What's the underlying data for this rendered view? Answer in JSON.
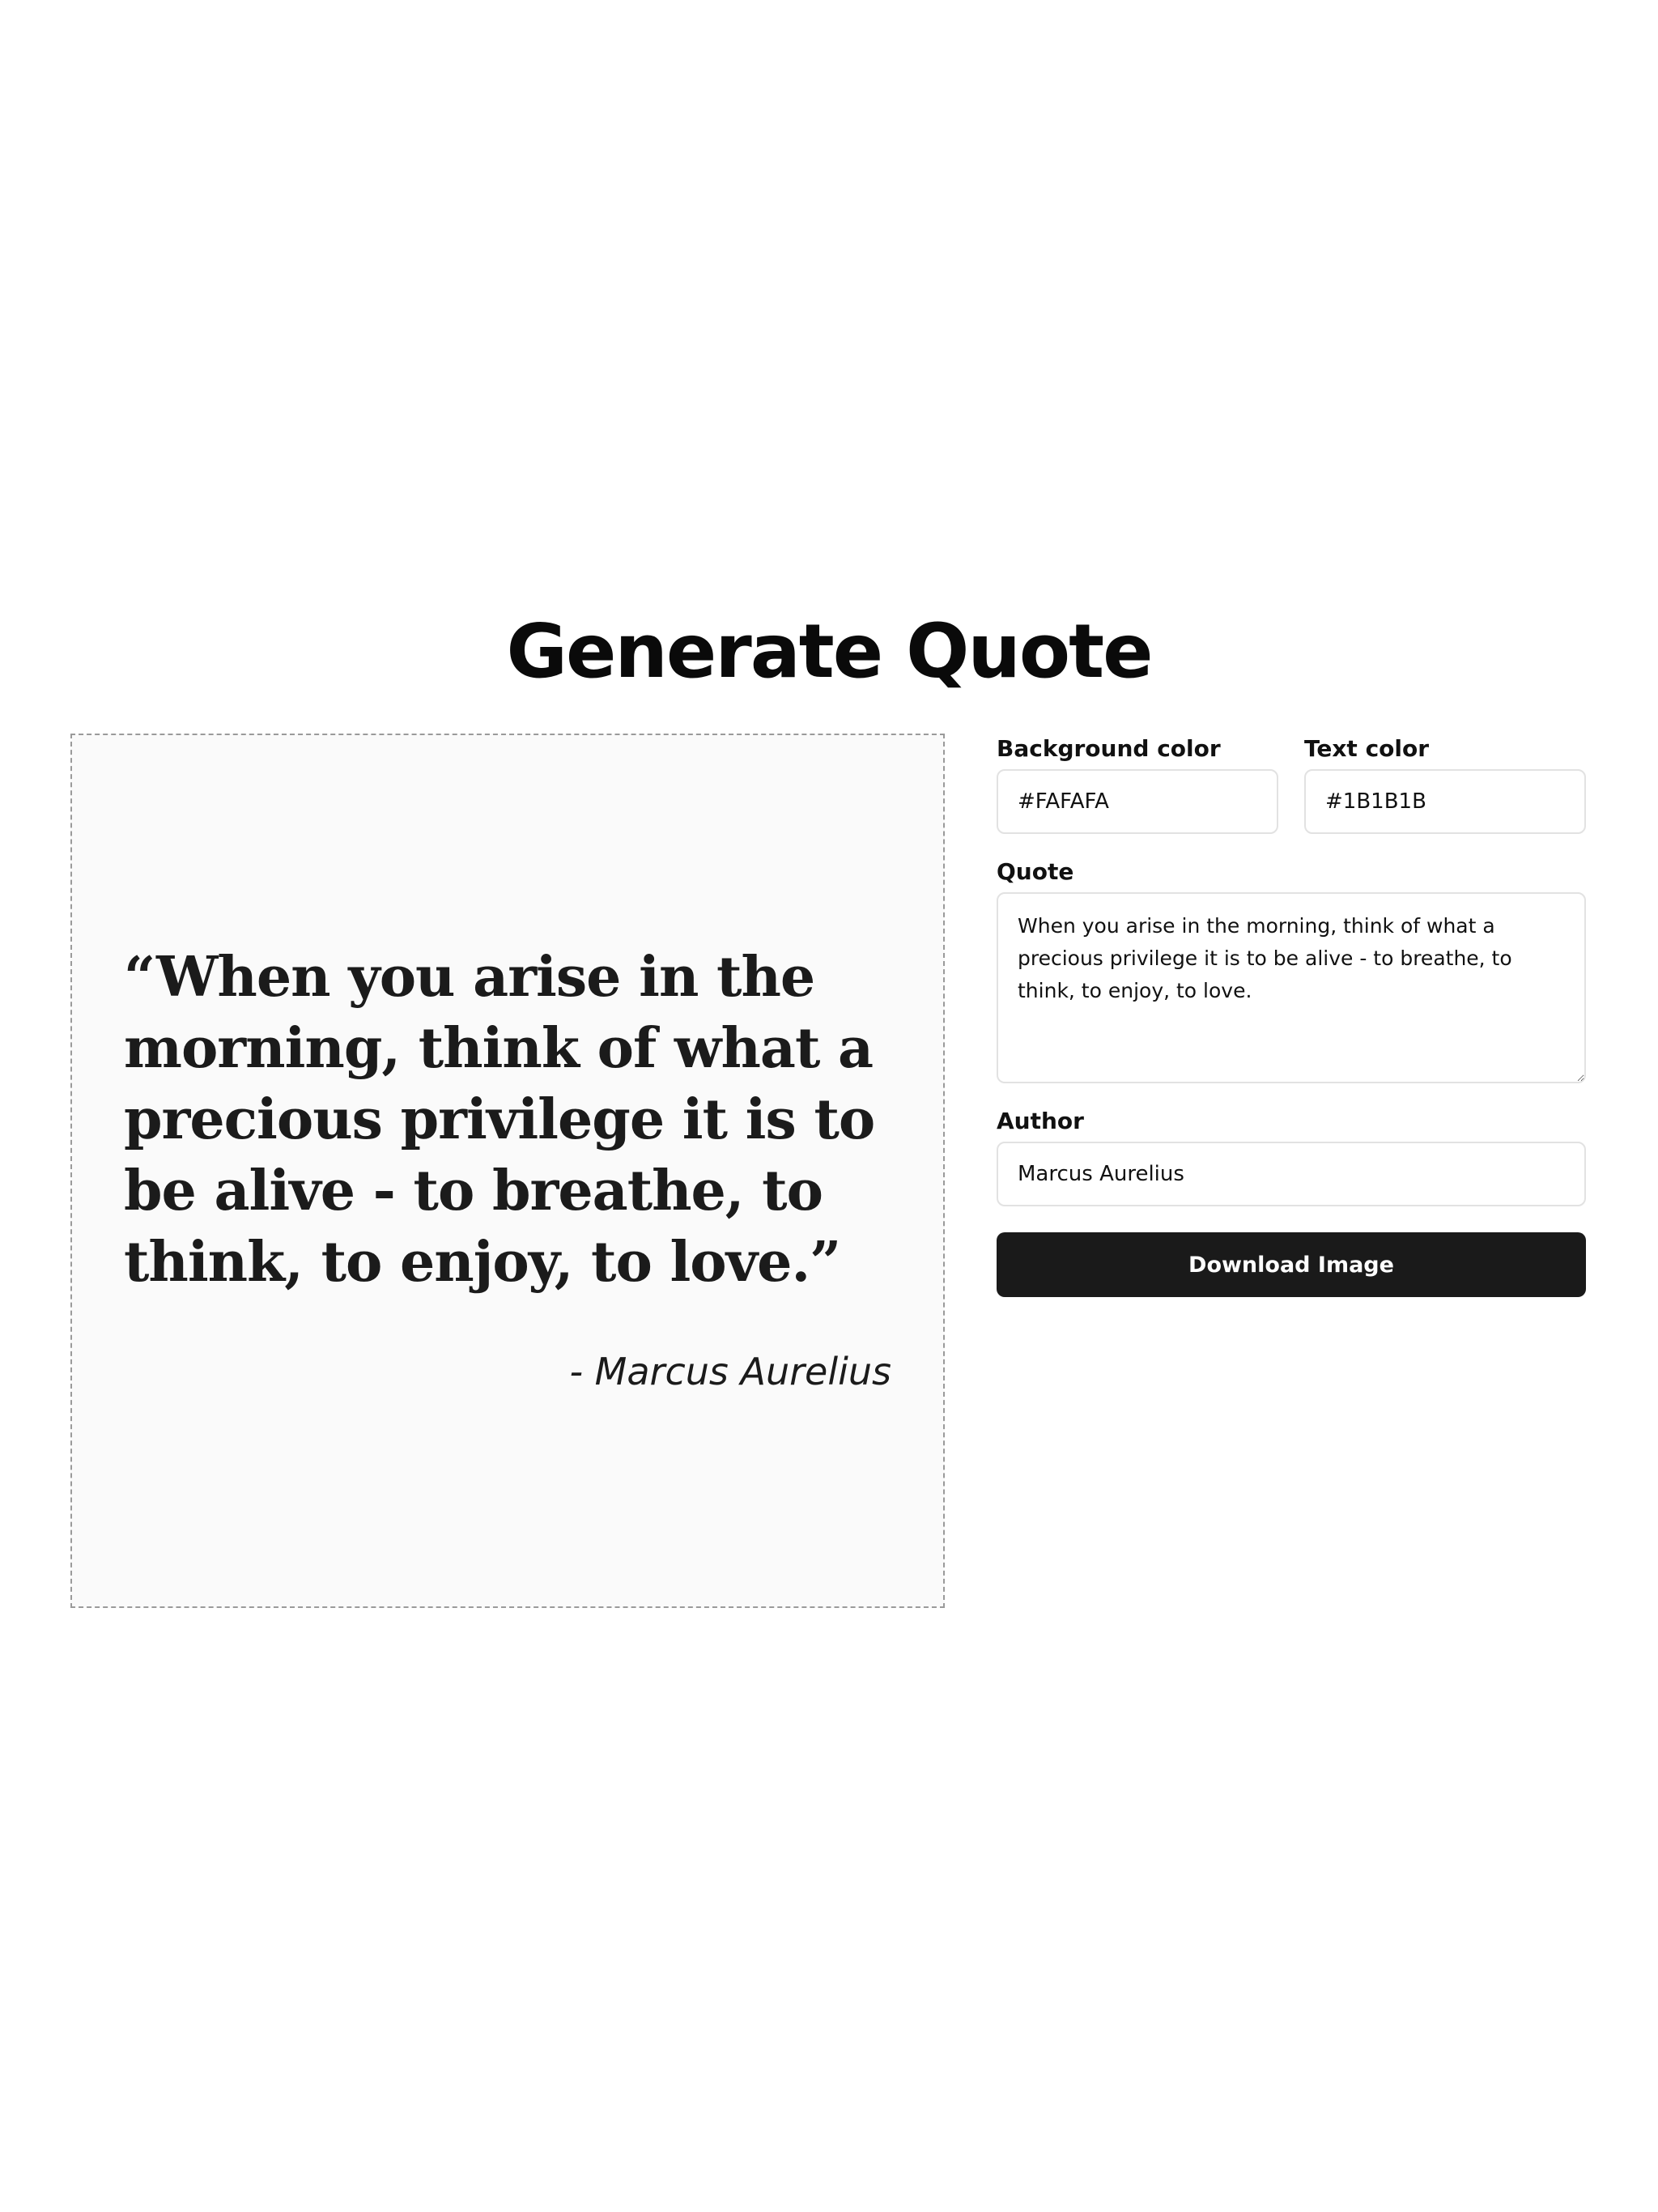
{
  "header": {
    "title": "Generate Quote"
  },
  "preview": {
    "quote_text": "“When you arise in the morning, think of what a precious privilege it is to be alive - to breathe, to think, to enjoy, to love.”",
    "author_text": "- Marcus Aurelius",
    "background_color": "#FAFAFA",
    "text_color": "#1B1B1B"
  },
  "form": {
    "background_color": {
      "label": "Background color",
      "value": "#FAFAFA"
    },
    "text_color": {
      "label": "Text color",
      "value": "#1B1B1B"
    },
    "quote": {
      "label": "Quote",
      "value": "When you arise in the morning, think of what a precious privilege it is to be alive - to breathe, to think, to enjoy, to love."
    },
    "author": {
      "label": "Author",
      "value": "Marcus Aurelius"
    },
    "download_label": "Download Image"
  },
  "colors": {
    "button_bg": "#1A1A1A",
    "input_border": "#E2E2E2",
    "preview_border": "#9A9A9A"
  }
}
